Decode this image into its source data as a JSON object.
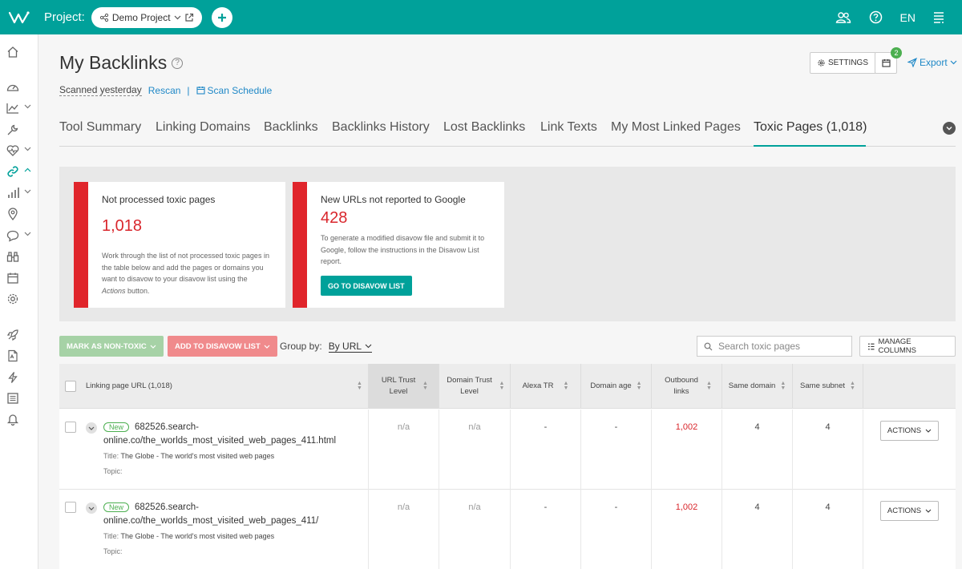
{
  "header": {
    "project_label": "Project:",
    "project_name": "Demo Project",
    "lang": "EN"
  },
  "page": {
    "title": "My Backlinks",
    "scanned": "Scanned yesterday",
    "rescan": "Rescan",
    "separator": "|",
    "schedule": "Scan Schedule",
    "settings": "SETTINGS",
    "notif_count": "2",
    "export": "Export"
  },
  "tabs": [
    {
      "label": "Tool Summary"
    },
    {
      "label": "Linking Domains"
    },
    {
      "label": "Backlinks"
    },
    {
      "label": "Backlinks History"
    },
    {
      "label": "Lost Backlinks"
    },
    {
      "label": "Link Texts"
    },
    {
      "label": "My Most Linked Pages"
    },
    {
      "label": "Toxic Pages (1,018)"
    }
  ],
  "cards": [
    {
      "heading": "Not processed toxic pages",
      "number": "1,018",
      "description_html": "Work through the list of not processed toxic pages in the table below and add the pages or domains you want to disavow to your disavow list using the <i>Actions</i> button."
    },
    {
      "heading": "New URLs not reported to Google",
      "number": "428",
      "description": "To generate a modified disavow file and submit it to Google, follow the instructions in the Disavow List report.",
      "button": "GO TO DISAVOW LIST"
    }
  ],
  "toolbar": {
    "mark_non_toxic": "MARK AS NON-TOXIC",
    "add_disavow": "ADD TO DISAVOW LIST",
    "group_label": "Group by:",
    "group_value": "By URL",
    "search_placeholder": "Search toxic pages",
    "manage_columns": "MANAGE COLUMNS"
  },
  "table": {
    "columns": [
      "Linking page URL (1,018)",
      "URL Trust Level",
      "Domain Trust Level",
      "Alexa TR",
      "Domain age",
      "Outbound links",
      "Same domain",
      "Same subnet"
    ],
    "rows": [
      {
        "badge": "New",
        "url": "682526.search-online.co/the_worlds_most_visited_web_pages_411.html",
        "title_label": "Title:",
        "title": "The Globe - The world's most visited web pages",
        "topic_label": "Topic:",
        "url_trust": "n/a",
        "domain_trust": "n/a",
        "alexa": "-",
        "domain_age": "-",
        "outbound": "1,002",
        "same_domain": "4",
        "same_subnet": "4",
        "action": "ACTIONS"
      },
      {
        "badge": "New",
        "url": "682526.search-online.co/the_worlds_most_visited_web_pages_411/",
        "title_label": "Title:",
        "title": "The Globe - The world's most visited web pages",
        "topic_label": "Topic:",
        "url_trust": "n/a",
        "domain_trust": "n/a",
        "alexa": "-",
        "domain_age": "-",
        "outbound": "1,002",
        "same_domain": "4",
        "same_subnet": "4",
        "action": "ACTIONS"
      }
    ]
  },
  "colors": {
    "accent": "#00a19a",
    "danger": "#e0252b",
    "link": "#1f88c7",
    "new": "#4caf50"
  },
  "icons": [
    "logo-icon",
    "share-icon",
    "external-link-icon",
    "plus-icon",
    "users-icon",
    "help-icon",
    "menu-icon",
    "home-icon",
    "dashboard-icon",
    "trend-icon",
    "wrench-icon",
    "pulse-icon",
    "link-icon",
    "bar-chart-icon",
    "location-icon",
    "chat-icon",
    "binoculars-icon",
    "calendar-icon",
    "gear-icon",
    "rocket-icon",
    "pdf-icon",
    "bolt-icon",
    "list-icon",
    "bell-icon",
    "search-icon",
    "columns-icon",
    "send-icon"
  ]
}
